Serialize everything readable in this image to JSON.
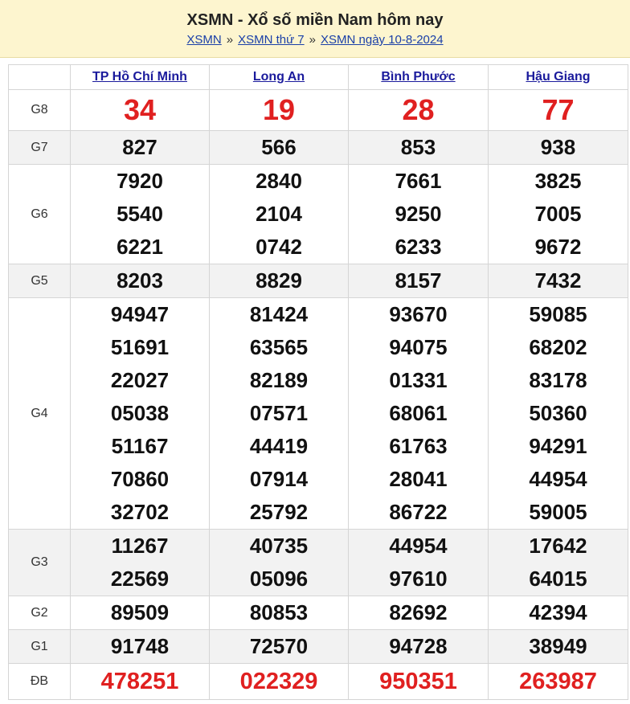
{
  "header": {
    "title": "XSMN - Xổ số miền Nam hôm nay",
    "breadcrumb": [
      "XSMN",
      "XSMN thứ 7",
      "XSMN ngày 10-8-2024"
    ],
    "separator": "»"
  },
  "provinces": [
    "TP Hồ Chí Minh",
    "Long An",
    "Bình Phước",
    "Hậu Giang"
  ],
  "prizes": [
    {
      "label": "G8",
      "style": "g8",
      "shade": false,
      "values": [
        [
          "34"
        ],
        [
          "19"
        ],
        [
          "28"
        ],
        [
          "77"
        ]
      ]
    },
    {
      "label": "G7",
      "style": "",
      "shade": true,
      "values": [
        [
          "827"
        ],
        [
          "566"
        ],
        [
          "853"
        ],
        [
          "938"
        ]
      ]
    },
    {
      "label": "G6",
      "style": "",
      "shade": false,
      "values": [
        [
          "7920",
          "5540",
          "6221"
        ],
        [
          "2840",
          "2104",
          "0742"
        ],
        [
          "7661",
          "9250",
          "6233"
        ],
        [
          "3825",
          "7005",
          "9672"
        ]
      ]
    },
    {
      "label": "G5",
      "style": "",
      "shade": true,
      "values": [
        [
          "8203"
        ],
        [
          "8829"
        ],
        [
          "8157"
        ],
        [
          "7432"
        ]
      ]
    },
    {
      "label": "G4",
      "style": "",
      "shade": false,
      "values": [
        [
          "94947",
          "51691",
          "22027",
          "05038",
          "51167",
          "70860",
          "32702"
        ],
        [
          "81424",
          "63565",
          "82189",
          "07571",
          "44419",
          "07914",
          "25792"
        ],
        [
          "93670",
          "94075",
          "01331",
          "68061",
          "61763",
          "28041",
          "86722"
        ],
        [
          "59085",
          "68202",
          "83178",
          "50360",
          "94291",
          "44954",
          "59005"
        ]
      ]
    },
    {
      "label": "G3",
      "style": "",
      "shade": true,
      "values": [
        [
          "11267",
          "22569"
        ],
        [
          "40735",
          "05096"
        ],
        [
          "44954",
          "97610"
        ],
        [
          "17642",
          "64015"
        ]
      ]
    },
    {
      "label": "G2",
      "style": "",
      "shade": false,
      "values": [
        [
          "89509"
        ],
        [
          "80853"
        ],
        [
          "82692"
        ],
        [
          "42394"
        ]
      ]
    },
    {
      "label": "G1",
      "style": "",
      "shade": true,
      "values": [
        [
          "91748"
        ],
        [
          "72570"
        ],
        [
          "94728"
        ],
        [
          "38949"
        ]
      ]
    },
    {
      "label": "ĐB",
      "style": "db",
      "shade": false,
      "values": [
        [
          "478251"
        ],
        [
          "022329"
        ],
        [
          "950351"
        ],
        [
          "263987"
        ]
      ]
    }
  ],
  "colors": {
    "special": "#e02020",
    "link": "#1a3fa8",
    "header_bg": "#fdf5cf"
  }
}
